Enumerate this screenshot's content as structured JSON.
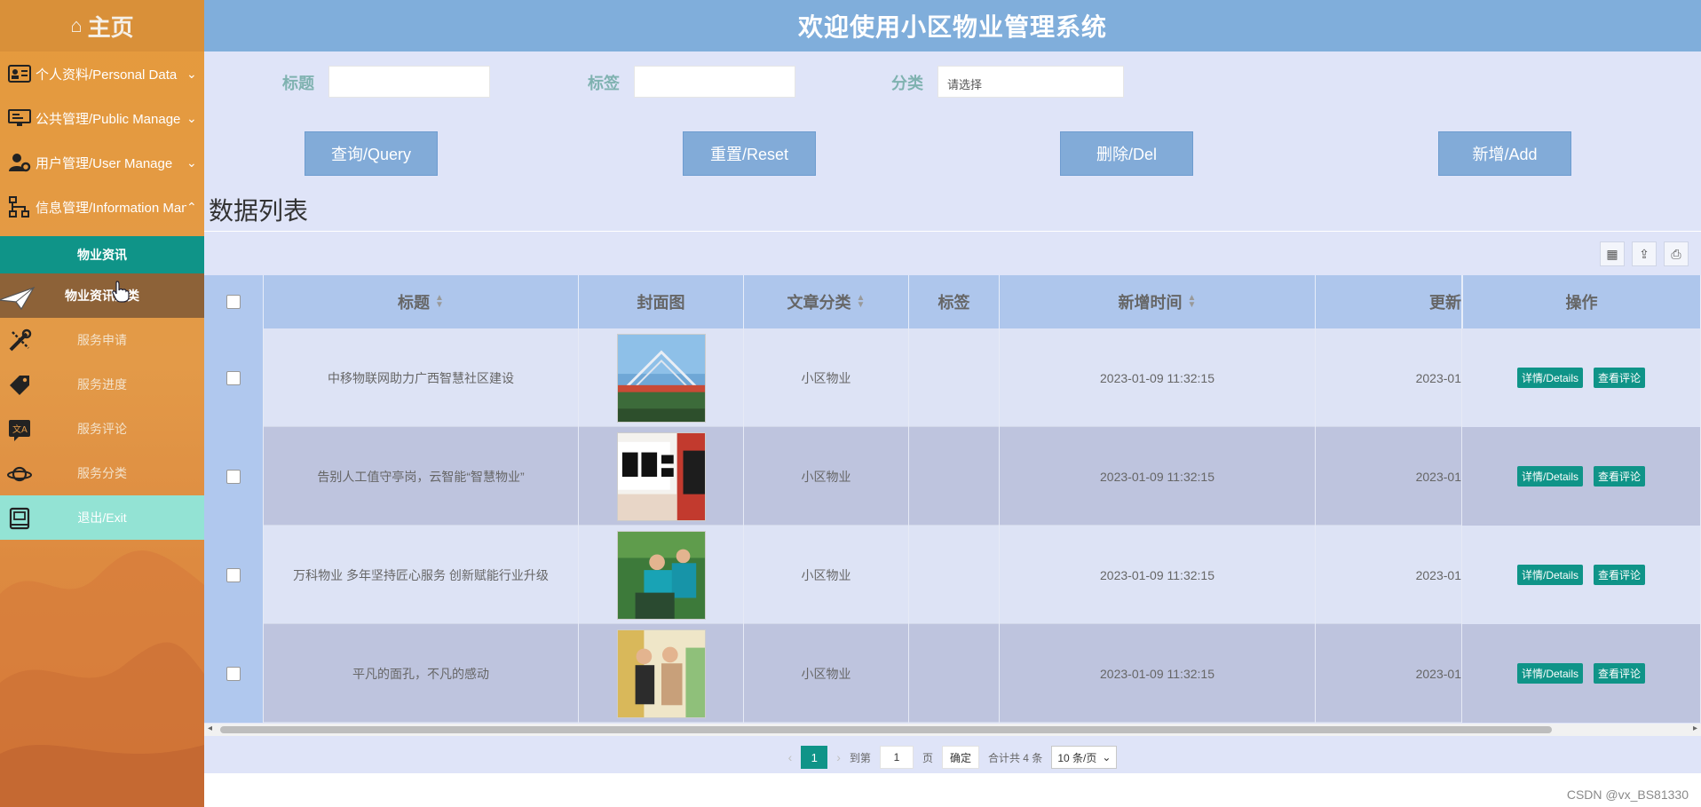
{
  "sidebar": {
    "home": "主页",
    "menus": [
      {
        "label": "个人资料/Personal Data",
        "icon": "id-card-icon"
      },
      {
        "label": "公共管理/Public Manage",
        "icon": "monitor-icon"
      },
      {
        "label": "用户管理/User Manage",
        "icon": "user-gear-icon"
      },
      {
        "label": "信息管理/Information Manage",
        "icon": "sitemap-icon"
      }
    ],
    "submenu_title": "物业资讯",
    "subitems": [
      {
        "label": "物业资讯分类",
        "icon": "paper-plane-icon"
      },
      {
        "label": "服务申请",
        "icon": "tools-icon"
      },
      {
        "label": "服务进度",
        "icon": "tag-icon"
      },
      {
        "label": "服务评论",
        "icon": "translate-icon"
      },
      {
        "label": "服务分类",
        "icon": "planet-icon"
      },
      {
        "label": "退出/Exit",
        "icon": "book-icon"
      }
    ]
  },
  "header": {
    "title": "欢迎使用小区物业管理系统"
  },
  "filters": {
    "title_label": "标题",
    "tag_label": "标签",
    "category_label": "分类",
    "category_placeholder": "请选择"
  },
  "buttons": {
    "query": "查询/Query",
    "reset": "重置/Reset",
    "delete": "删除/Del",
    "add": "新增/Add"
  },
  "list": {
    "title": "数据列表",
    "columns": [
      "标题",
      "封面图",
      "文章分类",
      "标签",
      "新增时间",
      "更新",
      "操作"
    ],
    "rows": [
      {
        "title": "中移物联网助力广西智慧社区建设",
        "category": "小区物业",
        "tag": "",
        "created": "2023-01-09 11:32:15",
        "updated": "2023-01",
        "detail": "详情/Details",
        "comments": "查看评论"
      },
      {
        "title": "告别人工值守亭岗，云智能“智慧物业”",
        "category": "小区物业",
        "tag": "",
        "created": "2023-01-09 11:32:15",
        "updated": "2023-01",
        "detail": "详情/Details",
        "comments": "查看评论"
      },
      {
        "title": "万科物业 多年坚持匠心服务 创新赋能行业升级",
        "category": "小区物业",
        "tag": "",
        "created": "2023-01-09 11:32:15",
        "updated": "2023-01",
        "detail": "详情/Details",
        "comments": "查看评论"
      },
      {
        "title": "平凡的面孔，不凡的感动",
        "category": "小区物业",
        "tag": "",
        "created": "2023-01-09 11:32:15",
        "updated": "2023-01",
        "detail": "详情/Details",
        "comments": "查看评论"
      }
    ]
  },
  "pager": {
    "current": "1",
    "goto_label": "到第",
    "goto_value": "1",
    "page_unit": "页",
    "confirm": "确定",
    "total": "合计共 4 条",
    "page_size": "10 条/页"
  },
  "watermark": "CSDN @vx_BS81330"
}
